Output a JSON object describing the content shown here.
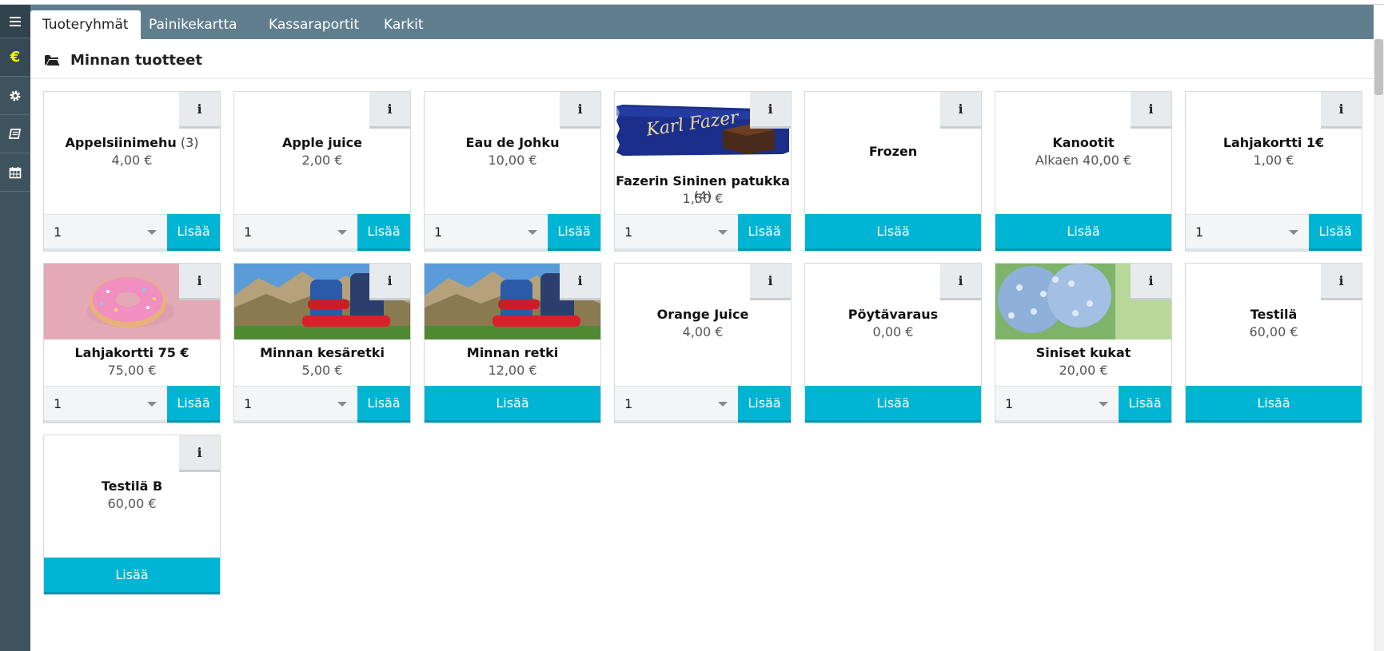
{
  "tabs": [
    {
      "label": "Tuoteryhmät"
    },
    {
      "label": "Painikekartta"
    },
    {
      "label": "Kassaraportit"
    },
    {
      "label": "Karkit"
    }
  ],
  "sidebar": {
    "icons": [
      "menu-icon",
      "euro-icon",
      "gear-icon",
      "book-icon",
      "calendar-icon"
    ],
    "euro_glyph": "€"
  },
  "page": {
    "title": "Minnan tuotteet"
  },
  "labels": {
    "info": "i",
    "add": "Lisää",
    "qty_default": "1"
  },
  "products": [
    {
      "name": "Appelsiinimehu",
      "count": "(3)",
      "price": "4,00 €",
      "image": null,
      "qty": true
    },
    {
      "name": "Apple juice",
      "count": "",
      "price": "2,00 €",
      "image": null,
      "qty": true
    },
    {
      "name": "Eau de Johku",
      "count": "",
      "price": "10,00 €",
      "image": null,
      "qty": true
    },
    {
      "name": "Fazerin Sininen patukka",
      "count": "(4)",
      "price": "1,50 €",
      "image": "chocolate-bar",
      "qty": true
    },
    {
      "name": "Frozen",
      "count": "",
      "price": "",
      "image": null,
      "qty": false
    },
    {
      "name": "Kanootit",
      "count": "",
      "price": "Alkaen 40,00 €",
      "image": null,
      "qty": false
    },
    {
      "name": "Lahjakortti 1€",
      "count": "",
      "price": "1,00 €",
      "image": null,
      "qty": true
    },
    {
      "name": "Lahjakortti 75 €",
      "count": "",
      "price": "75,00 €",
      "image": "donut",
      "qty": true
    },
    {
      "name": "Minnan kesäretki",
      "count": "",
      "price": "5,00 €",
      "image": "backpacks",
      "qty": true
    },
    {
      "name": "Minnan retki",
      "count": "",
      "price": "12,00 €",
      "image": "backpacks",
      "qty": false
    },
    {
      "name": "Orange Juice",
      "count": "",
      "price": "4,00 €",
      "image": null,
      "qty": true
    },
    {
      "name": "Pöytävaraus",
      "count": "",
      "price": "0,00 €",
      "image": null,
      "qty": false
    },
    {
      "name": "Siniset kukat",
      "count": "",
      "price": "20,00 €",
      "image": "flowers",
      "qty": true
    },
    {
      "name": "Testilä",
      "count": "",
      "price": "60,00 €",
      "image": null,
      "qty": false
    },
    {
      "name": "Testilä B",
      "count": "",
      "price": "60,00 €",
      "image": null,
      "qty": false
    }
  ],
  "colors": {
    "sidebar": "#3f535f",
    "tabbar": "#607e8e",
    "accent": "#00b5d4",
    "euro_active": "#f0ff00"
  }
}
